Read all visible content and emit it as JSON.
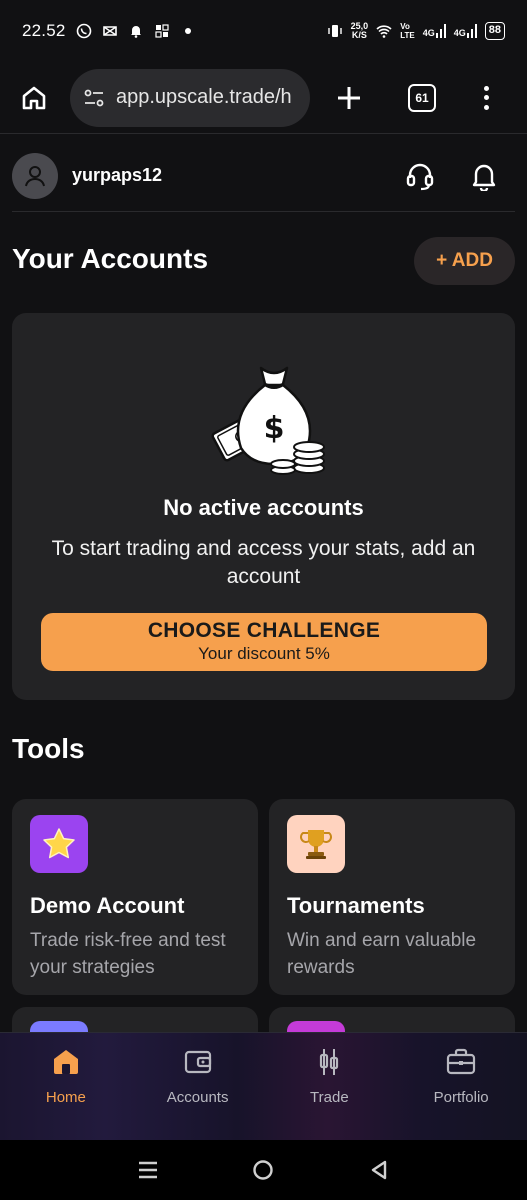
{
  "status_bar": {
    "time": "22.52",
    "speed_value": "25,0",
    "speed_unit": "K/S",
    "net_label_top": "Vo",
    "net_label_bottom": "LTE",
    "signal_1": "4G",
    "signal_2": "4G",
    "battery": "88"
  },
  "browser": {
    "url": "app.upscale.trade/h",
    "tab_count": "61"
  },
  "header": {
    "username": "yurpaps12"
  },
  "accounts": {
    "title": "Your Accounts",
    "add_label": "+ ADD",
    "empty_title": "No active accounts",
    "empty_desc": "To start trading and access your stats, add an account",
    "cta_main": "CHOOSE CHALLENGE",
    "cta_sub": "Your discount 5%"
  },
  "tools": {
    "title": "Tools",
    "items": [
      {
        "title": "Demo Account",
        "desc": "Trade risk-free and test your strategies",
        "icon": "star-icon",
        "icon_bg": "#9b44f0"
      },
      {
        "title": "Tournaments",
        "desc": "Win and earn valuable rewards",
        "icon": "trophy-icon",
        "icon_bg": "#ffd3bf"
      }
    ]
  },
  "bottom_nav": {
    "items": [
      {
        "label": "Home",
        "icon": "home-icon",
        "active": true
      },
      {
        "label": "Accounts",
        "icon": "wallet-icon",
        "active": false
      },
      {
        "label": "Trade",
        "icon": "candlestick-icon",
        "active": false
      },
      {
        "label": "Portfolio",
        "icon": "briefcase-icon",
        "active": false
      }
    ]
  },
  "colors": {
    "accent": "#f6a04d",
    "background": "#111113",
    "card": "#232325"
  }
}
